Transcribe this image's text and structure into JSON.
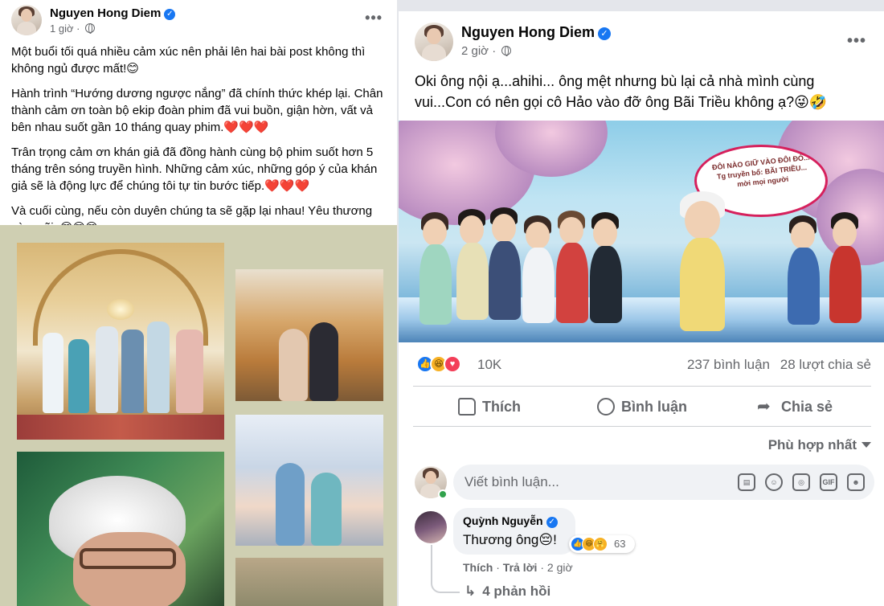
{
  "left_post": {
    "author": "Nguyen Hong Diem",
    "time": "1 giờ",
    "more": "•••",
    "paragraphs": [
      "Một buổi tối quá nhiều cảm xúc nên phải lên hai bài post không thì không ngủ được mất!😊",
      " Hành trình “Hướng dương ngược nắng” đã chính thức khép lại. Chân thành cảm ơn toàn bộ ekip đoàn phim đã vui buồn, giận hờn, vất vả bên nhau suốt gần 10 tháng quay phim.❤️❤️❤️",
      "  Trân trọng cảm ơn khán giả đã đồng hành cùng bộ phim suốt hơn 5 tháng trên sóng truyền hình. Những cảm xúc, những góp ý của khán giả sẽ là động lực để chúng tôi tự tin bước tiếp.❤️❤️❤️",
      "Và cuối cùng, nếu còn duyên chúng ta sẽ gặp lại nhau! Yêu thương còn mãi..😍😍😍"
    ]
  },
  "right_post": {
    "author": "Nguyen Hong Diem",
    "time": "2 giờ",
    "more": "•••",
    "text": "Oki ông nội ạ...ahihi... ông mệt nhưng bù lại cả nhà mình cùng vui...Con có nên gọi cô Hảo vào đỡ ông Bãi Triều không ạ?😜🤣",
    "banner_bubble": "ĐÔI NÀO GIỮ VÀO ĐÔI ĐÓ... Tg truyền bổ: BÃI TRIỀU... mời mọi người",
    "reaction_count": "10K",
    "comments_count": "237 bình luận",
    "shares_count": "28 lượt chia sẻ",
    "actions": {
      "like": "Thích",
      "comment": "Bình luận",
      "share": "Chia sẻ"
    },
    "sort_label": "Phù hợp nhất",
    "composer_placeholder": "Viết bình luận...",
    "composer_icons": [
      "sticker-icon",
      "emoji-icon",
      "camera-icon",
      "gif-icon",
      "sticker-face-icon"
    ],
    "comment": {
      "author": "Quỳnh Nguyễn",
      "text": "Thương ông😔!",
      "reaction_count": "63",
      "like_label": "Thích",
      "separator": "·",
      "reply_label": "Trả lời",
      "time": "2 giờ"
    },
    "replies_label": "4 phản hồi"
  },
  "colors": {
    "facebook_blue": "#1877f2",
    "secondary_text": "#65676b",
    "love_red": "#f33e58",
    "haha_yellow": "#f7b125",
    "online_green": "#31a24c",
    "left_media_bg": "#cfcfb2"
  }
}
